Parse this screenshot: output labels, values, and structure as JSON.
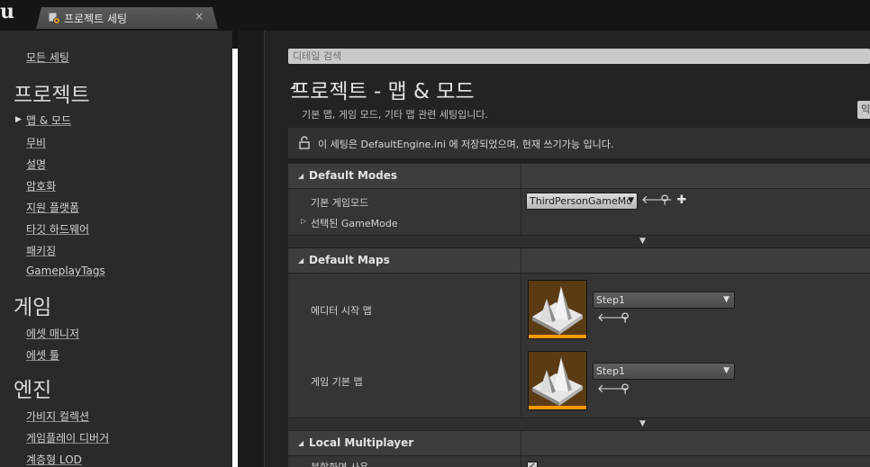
{
  "titlebar": {
    "logo": "u",
    "tab_label": "프로젝트 세팅",
    "tab_icon": "settings-gear-icon",
    "close_label": "×"
  },
  "nav": {
    "all_settings": "모든 세팅",
    "categories": [
      {
        "title": "프로젝트",
        "items": [
          "맵 & 모드",
          "무비",
          "설명",
          "암호화",
          "지원 플랫폼",
          "타깃 하드웨어",
          "패키징",
          "GameplayTags"
        ]
      },
      {
        "title": "게임",
        "items": [
          "에셋 매니저",
          "에셋 툴"
        ]
      },
      {
        "title": "엔진",
        "items": [
          "가비지 컬렉션",
          "게임플레이 디버거",
          "계층형 LOD"
        ]
      }
    ],
    "active_arrow": "▶"
  },
  "main": {
    "search_placeholder": "디테일 검색",
    "title": "프로젝트 - 맵 & 모드",
    "title_arrow": "◢",
    "description": "기본 맵, 게임 모드, 기타 맵 관련 세팅입니다.",
    "side_button": "익",
    "info": "이 세팅은 DefaultEngine.ini 에 저장되었으며, 현재 쓰기가능 입니다.",
    "sections": {
      "default_modes": {
        "label": "Default Modes",
        "rows": {
          "game_mode_label": "기본 게임모드",
          "game_mode_value": "ThirdPersonGameMc",
          "selected_gamemode_label": "선택된 GameMode"
        }
      },
      "default_maps": {
        "label": "Default Maps",
        "rows": {
          "editor_startup_label": "에디터 시작 맵",
          "editor_startup_value": "Step1",
          "game_default_label": "게임 기본 맵",
          "game_default_value": "Step1"
        }
      },
      "local_multiplayer": {
        "label": "Local Multiplayer",
        "rows": {
          "split_screen_label": "분할화면 사용"
        }
      }
    }
  },
  "icons": {
    "arrow_left": "🡐",
    "search": "⚲",
    "plus": "✚",
    "chevron_down": "▼",
    "check": "✓"
  },
  "colors": {
    "accent": "#ff9800",
    "panel": "#353535",
    "header": "#3d3d3d"
  }
}
